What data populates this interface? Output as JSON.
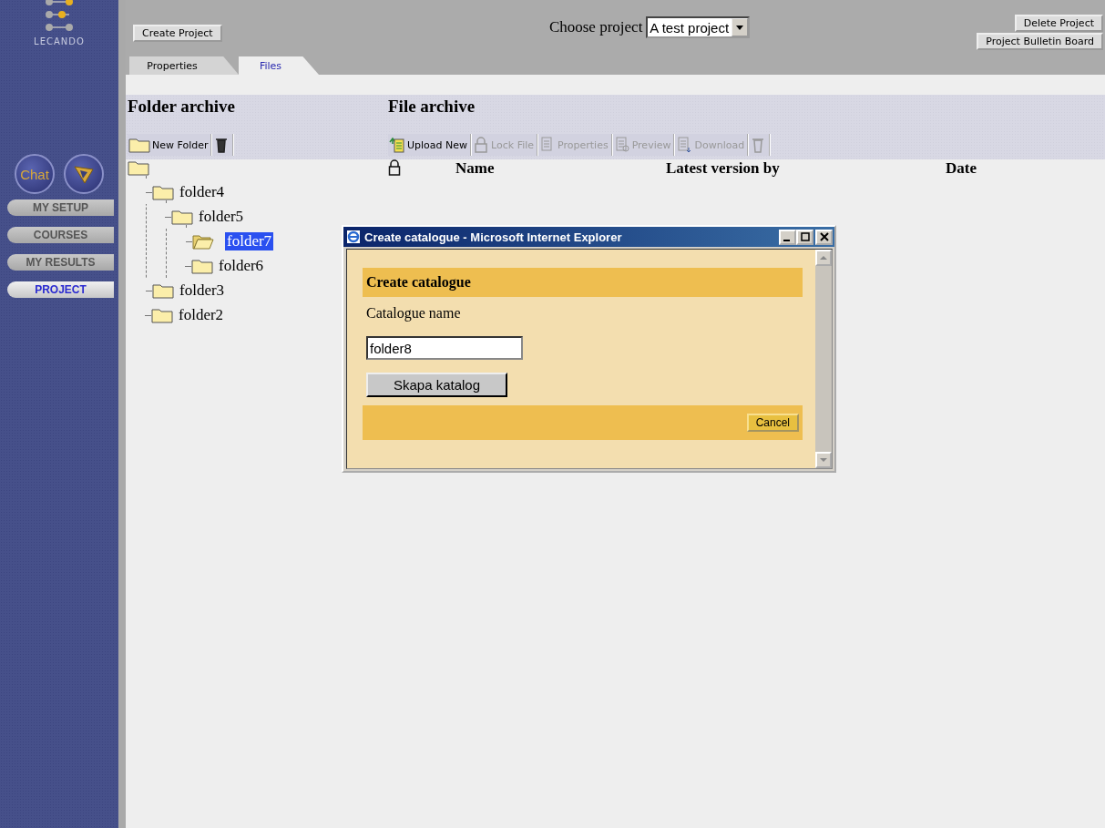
{
  "sidebar": {
    "logo": "LECANDO",
    "chat_button": "Chat",
    "nav": [
      {
        "label": "MY SETUP",
        "selected": false
      },
      {
        "label": "COURSES",
        "selected": false
      },
      {
        "label": "MY RESULTS",
        "selected": false
      },
      {
        "label": "PROJECT",
        "selected": true
      }
    ]
  },
  "header": {
    "create_button": "Create Project",
    "project_label": "Choose project",
    "project_select": "A test project",
    "buttons": [
      "Delete Project",
      "Project Bulletin Board"
    ]
  },
  "tabs": [
    {
      "label": "Properties",
      "selected": false
    },
    {
      "label": "Files",
      "selected": true
    }
  ],
  "folder_archive": {
    "title": "Folder archive",
    "new_folder_button": "New Folder",
    "tree": [
      {
        "label": "folder4",
        "selected": false,
        "children": [
          {
            "label": "folder5",
            "selected": false,
            "children": [
              {
                "label": "folder7",
                "selected": true
              },
              {
                "label": "folder6",
                "selected": false
              }
            ]
          }
        ]
      },
      {
        "label": "folder3",
        "selected": false
      },
      {
        "label": "folder2",
        "selected": false
      }
    ]
  },
  "file_archive": {
    "title": "File archive",
    "toolbar": [
      {
        "kind": "upload",
        "label": "Upload New",
        "disabled": false
      },
      {
        "kind": "lock",
        "label": "Lock File",
        "disabled": true
      },
      {
        "kind": "properties",
        "label": "Properties",
        "disabled": true
      },
      {
        "kind": "preview",
        "label": "Preview",
        "disabled": true
      },
      {
        "kind": "download",
        "label": "Download",
        "disabled": true
      },
      {
        "kind": "delete",
        "disabled": true
      }
    ],
    "columns": [
      "Name",
      "Latest version by",
      "Date"
    ]
  },
  "dialog": {
    "title": "Create catalogue - Microsoft Internet Explorer",
    "heading": "Create catalogue",
    "field_label": "Catalogue name",
    "field_value": "folder8",
    "submit_button": "Skapa katalog",
    "cancel_button": "Cancel"
  }
}
